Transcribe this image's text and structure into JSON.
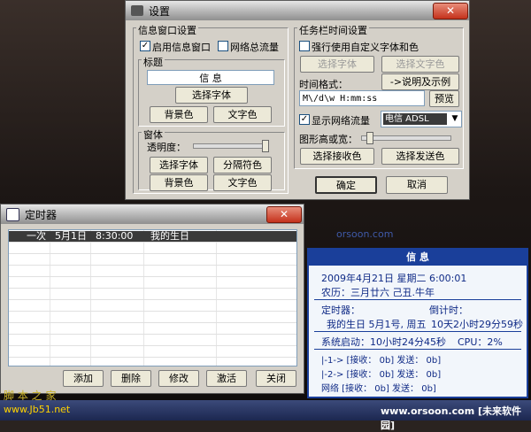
{
  "desktop": {
    "bottom_text": "www.orsoon.com [未来软件园]",
    "mid_watermark": "orsoon.com",
    "wm1": "脚 本 之 家",
    "wm2": "www.Jb51.net"
  },
  "settings": {
    "title": "设置",
    "info_group": "信息窗口设置",
    "enable_info": "启用信息窗口",
    "net_total": "网络总流量",
    "title_section": "标题",
    "title_value": "信      息",
    "choose_font": "选择字体",
    "bg_color": "背景色",
    "text_color": "文字色",
    "window_section": "窗体",
    "transparency": "透明度：",
    "choose_font2": "选择字体",
    "sep_color": "分隔符色",
    "bg_color2": "背景色",
    "text_color2": "文字色",
    "taskbar_group": "任务栏时间设置",
    "force_custom": "强行使用自定义字体和色",
    "choose_font3": "选择字体",
    "choose_text_color": "选择文字色",
    "time_format": "时间格式：",
    "explain": "->说明及示例",
    "format_value": "M\\/d\\w H:mm:ss",
    "preview": "预览",
    "show_traffic": "显示网络流量",
    "adapter": "电信 ADSL",
    "graph_height": "图形高或宽：",
    "recv_color": "选择接收色",
    "send_color": "选择发送色",
    "ok": "确定",
    "cancel": "取消"
  },
  "timer": {
    "title": "定时器",
    "rows": [
      {
        "freq": "一次",
        "date": "5月1日",
        "time": "8:30:00",
        "name": "我的生日"
      }
    ],
    "add": "添加",
    "delete": "删除",
    "edit": "修改",
    "activate": "激活",
    "close": "关闭"
  },
  "info_panel": {
    "header": "信      息",
    "date_line": "2009年4月21日 星期二     6:00:01",
    "lunar": "农历：三月廿六    己丑.牛年",
    "timer_label": "定时器：",
    "countdown_label": "倒计时：",
    "timer_item": "我的生日 5月1号, 周五",
    "countdown_value": "10天2小时29分59秒",
    "uptime": "系统启动：10小时24分45秒",
    "cpu": "CPU：2%",
    "net1": "|-1-> [接收：         0b]  发送：       0b]",
    "net2": "|-2-> [接收：         0b]  发送：       0b]",
    "net3": "网络   [接收：         0b]  发送：       0b]"
  },
  "colors": {
    "accent": "#1a3f9a",
    "close_red": "#c4321c"
  }
}
